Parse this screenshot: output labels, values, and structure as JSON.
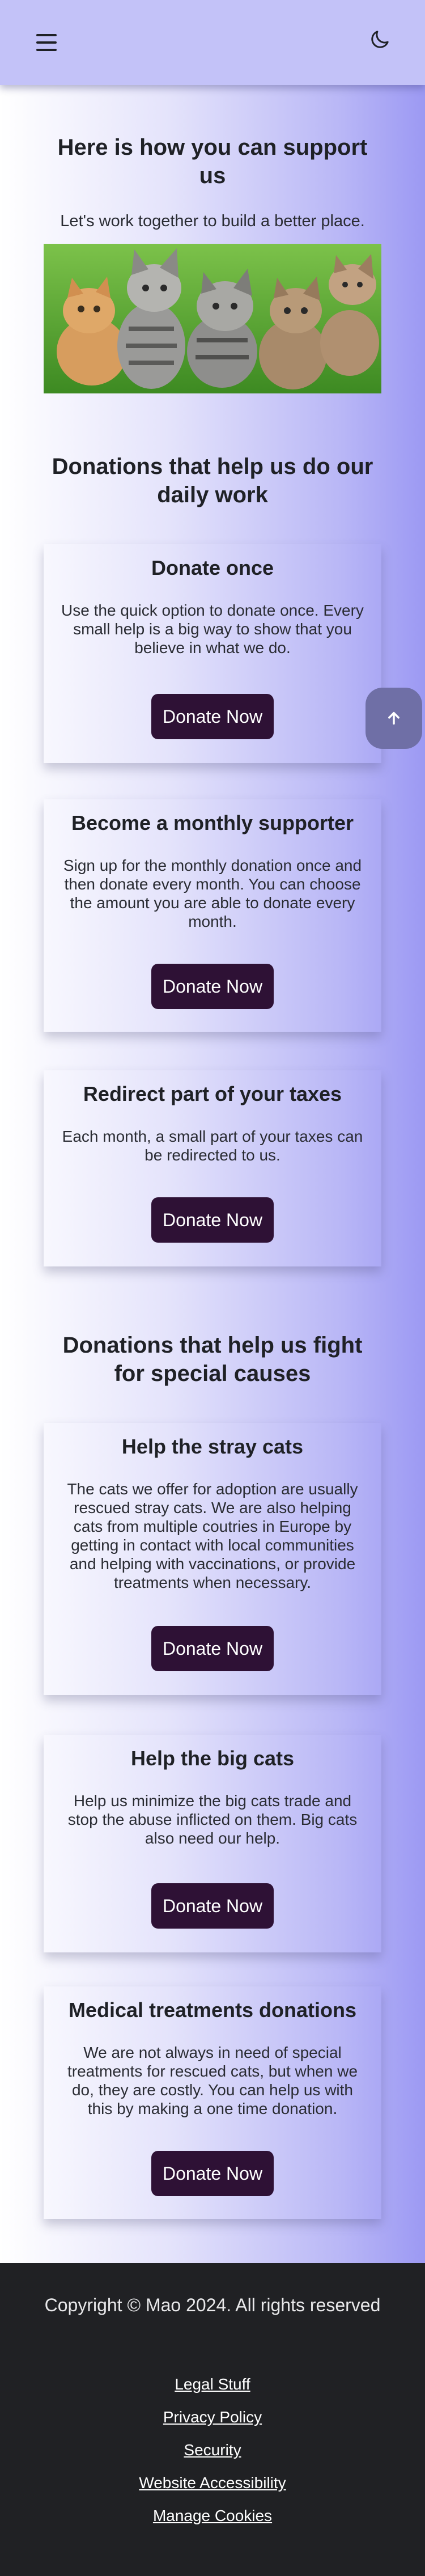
{
  "header": {
    "menu_icon": "hamburger-menu-icon",
    "theme_icon": "moon-icon"
  },
  "intro": {
    "title": "Here is how you can support us",
    "subtitle": "Let's work together to build a better place."
  },
  "daily": {
    "title": "Donations that help us do our daily work",
    "cards": [
      {
        "title": "Donate once",
        "text": "Use the quick option to donate once. Every small help is a big way to show that you believe in what we do.",
        "button": "Donate Now"
      },
      {
        "title": "Become a monthly supporter",
        "text": "Sign up for the monthly donation once and then donate every month. You can choose the amount you are able to donate every month.",
        "button": "Donate Now"
      },
      {
        "title": "Redirect part of your taxes",
        "text": "Each month, a small part of your taxes can be redirected to us.",
        "button": "Donate Now"
      }
    ]
  },
  "special": {
    "title": "Donations that help us fight for special causes",
    "cards": [
      {
        "title": "Help the stray cats",
        "text": "The cats we offer for adoption are usually rescued stray cats. We are also helping cats from multiple coutries in Europe by getting in contact with local communities and helping with vaccinations, or provide treatments when necessary.",
        "button": "Donate Now"
      },
      {
        "title": "Help the big cats",
        "text": "Help us minimize the big cats trade and stop the abuse inflicted on them. Big cats also need our help.",
        "button": "Donate Now"
      },
      {
        "title": "Medical treatments donations",
        "text": "We are not always in need of special treatments for rescued cats, but when we do, they are costly. You can help us with this by making a one time donation.",
        "button": "Donate Now"
      }
    ]
  },
  "scroll_top_icon": "arrow-up-icon",
  "footer": {
    "copyright": "Copyright © Mao 2024. All rights reserved",
    "links": [
      "Legal Stuff",
      "Privacy Policy",
      "Security",
      "Website Accessibility",
      "Manage Cookies"
    ]
  },
  "colors": {
    "header": "#c3c2f8",
    "button": "#2e1135",
    "footer": "#202124"
  }
}
